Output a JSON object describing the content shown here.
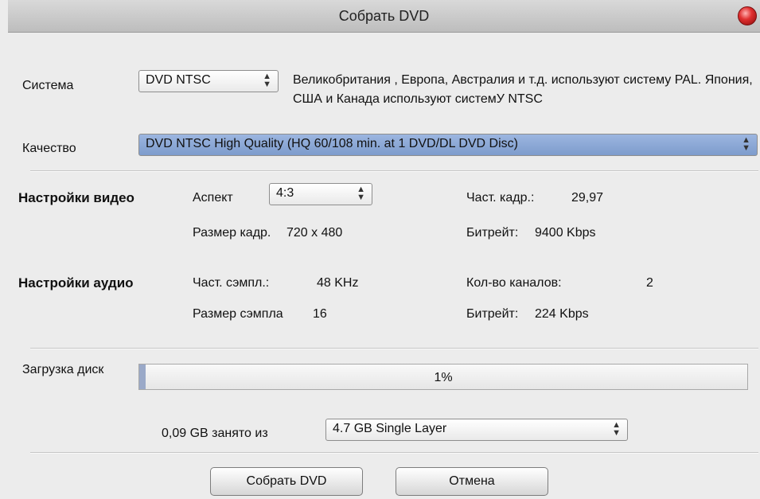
{
  "window": {
    "title": "Собрать DVD"
  },
  "system": {
    "label": "Система",
    "value": "DVD NTSC",
    "description": "Великобритания , Европа, Австралия и т.д. используют систему PAL. Япония, США и Канада используют системУ NTSC"
  },
  "quality": {
    "label": "Качество",
    "value": "DVD NTSC High Quality (HQ 60/108 min. at 1 DVD/DL DVD Disc)"
  },
  "video": {
    "heading": "Настройки видео",
    "aspect_label": "Аспект",
    "aspect_value": "4:3",
    "framerate_label": "Част. кадр.:",
    "framerate_value": "29,97",
    "framesize_label": "Размер кадр.",
    "framesize_value": "720 x 480",
    "bitrate_label": "Битрейт:",
    "bitrate_value": "9400 Kbps"
  },
  "audio": {
    "heading": "Настройки аудио",
    "samplerate_label": "Част. сэмпл.:",
    "samplerate_value": "48 KHz",
    "channels_label": "Кол-во каналов:",
    "channels_value": "2",
    "samplesize_label": "Размер сэмпла",
    "samplesize_value": "16",
    "bitrate_label": "Битрейт:",
    "bitrate_value": "224 Kbps"
  },
  "disc": {
    "load_label": "Загрузка диск",
    "progress_text": "1%",
    "progress_fraction": 0.01,
    "used_text": "0,09 GB занято из",
    "disc_type": "4.7 GB Single Layer"
  },
  "buttons": {
    "build": "Собрать DVD",
    "cancel": "Отмена"
  },
  "colors": {
    "close": "#e03030",
    "highlight": "#7d9ccc",
    "progress_fill": "#9aa9c8"
  },
  "icons": {
    "close": "red-close-circle-icon",
    "select_arrows": "up-down-arrows-icon"
  }
}
